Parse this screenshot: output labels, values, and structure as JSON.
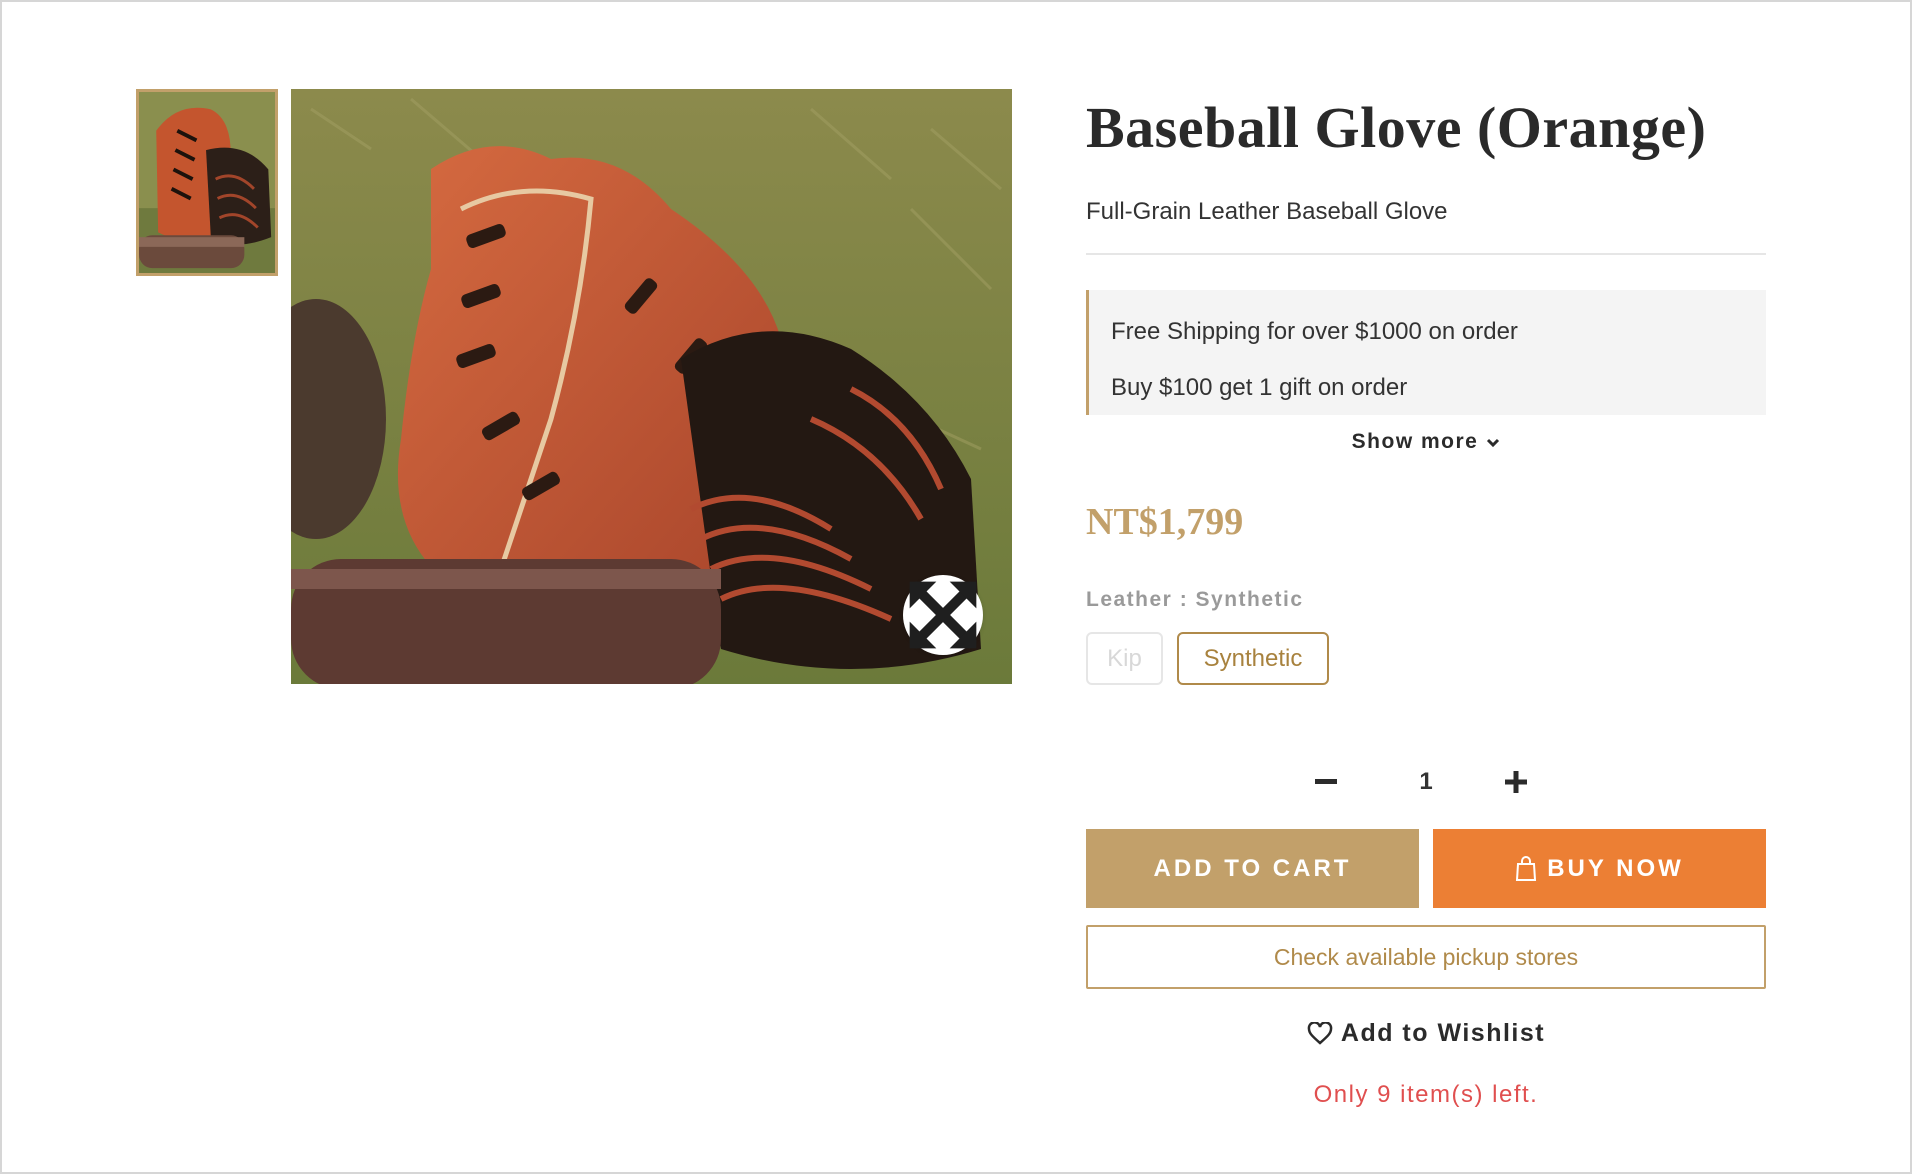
{
  "product": {
    "title": "Baseball Glove (Orange)",
    "subtitle": "Full-Grain Leather Baseball Glove",
    "price": "NT$1,799"
  },
  "promotions": {
    "items": [
      "Free Shipping for over $1000 on order",
      "Buy $100 get 1 gift on order"
    ],
    "show_more_label": "Show more"
  },
  "variant": {
    "label": "Leather : Synthetic",
    "options": [
      {
        "label": "Kip",
        "state": "unavailable"
      },
      {
        "label": "Synthetic",
        "state": "selected"
      }
    ]
  },
  "quantity": {
    "value": "1"
  },
  "actions": {
    "add_to_cart": "ADD TO CART",
    "buy_now": "BUY NOW",
    "pickup": "Check available pickup stores",
    "wishlist": "Add to Wishlist"
  },
  "stock_message": "Only 9 item(s) left.",
  "icons": {
    "zoom": "expand-arrows-icon",
    "chevron": "chevron-down-icon",
    "minus": "minus-icon",
    "plus": "plus-icon",
    "bag": "shopping-bag-icon",
    "heart": "heart-outline-icon"
  },
  "colors": {
    "accent_gold": "#c2a06a",
    "buy_orange": "#ec7f34",
    "stock_red": "#e04f4f"
  }
}
